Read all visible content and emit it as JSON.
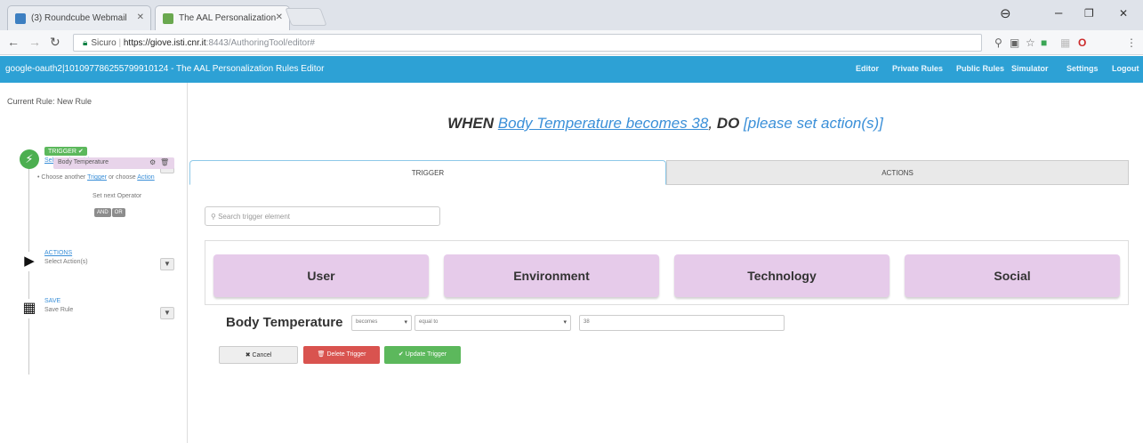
{
  "browser": {
    "tabs": [
      {
        "title": "(3) Roundcube Webmail",
        "active": false
      },
      {
        "title": "The AAL Personalization",
        "active": true
      }
    ],
    "url": {
      "security": "Sicuro",
      "host": "https://giove.isti.cnr.it",
      "path": ":8443/AuthoringTool/editor#"
    }
  },
  "app": {
    "title": "google-oauth2|101097786255799910124 - The AAL Personalization Rules Editor",
    "nav": [
      "Editor",
      "Private Rules",
      "Public Rules",
      "Simulator",
      "Settings",
      "Logout"
    ]
  },
  "sidebar": {
    "current_rule": "Current Rule: New Rule",
    "trigger": {
      "badge": "TRIGGER ✔",
      "link": "Select Trigger(s)",
      "item": "Body Temperature",
      "choose_another": "Choose another",
      "trigger_link": "Trigger",
      "or_choose": "or choose",
      "action_link": "Action",
      "operator_label": "Set next Operator",
      "operators": [
        "AND",
        "OR"
      ]
    },
    "action": {
      "badge": "ACTIONS",
      "sub": "Select Action(s)"
    },
    "save": {
      "badge": "SAVE",
      "sub": "Save Rule"
    }
  },
  "main": {
    "when": {
      "kw_when": "WHEN",
      "trigger_text": "Body Temperature becomes 38",
      "kw_do": "DO",
      "action_placeholder": "[please set action(s)]"
    },
    "tabs": {
      "trigger": "TRIGGER",
      "actions": "ACTIONS"
    },
    "search_placeholder": "Search trigger element",
    "categories": [
      "User",
      "Environment",
      "Technology",
      "Social"
    ],
    "condition": {
      "label": "Body Temperature",
      "op1": "becomes",
      "op2": "equal to",
      "value": "38"
    },
    "buttons": {
      "cancel": "Cancel",
      "delete": "Delete Trigger",
      "update": "Update Trigger"
    }
  },
  "colors": {
    "appbar": "#2da1d5",
    "category": "#e6cbea",
    "green": "#5cb85c",
    "red": "#d9534f",
    "link": "#3a8fd8"
  }
}
